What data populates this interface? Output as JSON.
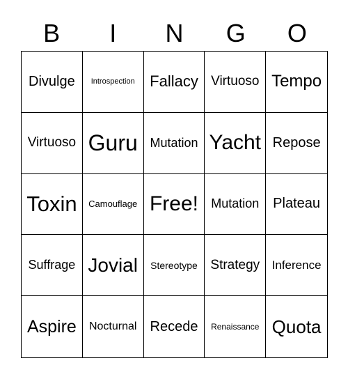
{
  "header": [
    "B",
    "I",
    "N",
    "G",
    "O"
  ],
  "cells": [
    [
      "Divulge",
      "Introspection",
      "Fallacy",
      "Virtuoso",
      "Tempo"
    ],
    [
      "Virtuoso",
      "Guru",
      "Mutation",
      "Yacht",
      "Repose"
    ],
    [
      "Toxin",
      "Camouflage",
      "Free!",
      "Mutation",
      "Plateau"
    ],
    [
      "Suffrage",
      "Jovial",
      "Stereotype",
      "Strategy",
      "Inference"
    ],
    [
      "Aspire",
      "Nocturnal",
      "Recede",
      "Renaissance",
      "Quota"
    ]
  ]
}
